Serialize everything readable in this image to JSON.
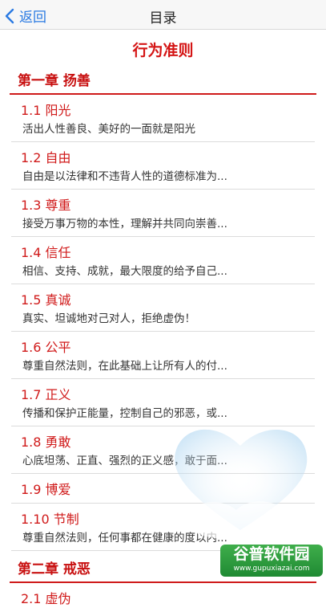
{
  "nav": {
    "back_label": "返回",
    "title": "目录"
  },
  "page_title": "行为准则",
  "chapters": [
    {
      "title": "第一章 扬善",
      "items": [
        {
          "title": "1.1 阳光",
          "desc": "活出人性善良、美好的一面就是阳光"
        },
        {
          "title": "1.2 自由",
          "desc": "自由是以法律和不违背人性的道德标准为..."
        },
        {
          "title": "1.3 尊重",
          "desc": "接受万事万物的本性，理解并共同向崇善..."
        },
        {
          "title": "1.4 信任",
          "desc": "相信、支持、成就，最大限度的给予自己..."
        },
        {
          "title": "1.5 真诚",
          "desc": "真实、坦诚地对己对人，拒绝虚伪！"
        },
        {
          "title": "1.6 公平",
          "desc": "尊重自然法则，在此基础上让所有人的付..."
        },
        {
          "title": "1.7 正义",
          "desc": "传播和保护正能量，控制自己的邪恶，或..."
        },
        {
          "title": "1.8 勇敢",
          "desc": "心底坦荡、正直、强烈的正义感，敢于面..."
        },
        {
          "title": "1.9 博爱",
          "desc": ""
        },
        {
          "title": "1.10 节制",
          "desc": "尊重自然法则，任何事都在健康的度以内..."
        }
      ]
    },
    {
      "title": "第二章 戒恶",
      "items": [
        {
          "title": "2.1 虚伪",
          "desc": ""
        }
      ]
    }
  ],
  "watermark": {
    "text": "谷普软件园",
    "url": "www.gupuxiazai.com"
  },
  "colors": {
    "accent_red": "#d01a1a",
    "link_blue": "#2a7ae2"
  }
}
